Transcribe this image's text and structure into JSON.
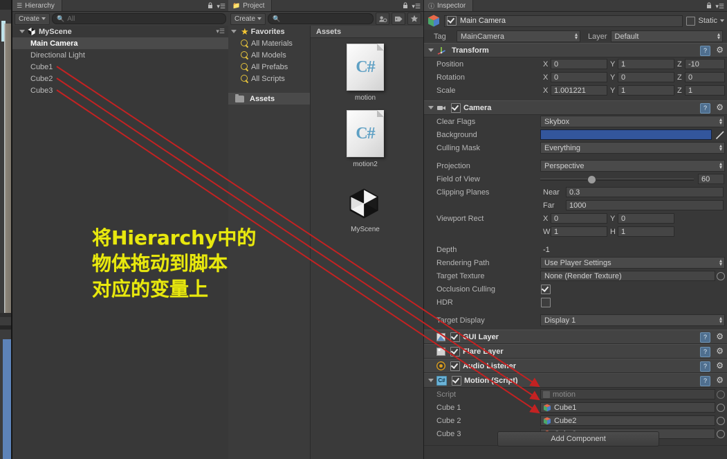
{
  "hierarchy": {
    "tab_label": "Hierarchy",
    "tab_icon": "hierarchy-icon",
    "create_label": "Create",
    "search_placeholder": "All",
    "scene_name": "MyScene",
    "items": [
      {
        "label": "Main Camera",
        "selected": true
      },
      {
        "label": "Directional Light",
        "selected": false
      },
      {
        "label": "Cube1",
        "selected": false
      },
      {
        "label": "Cube2",
        "selected": false
      },
      {
        "label": "Cube3",
        "selected": false
      }
    ]
  },
  "project": {
    "tab_label": "Project",
    "create_label": "Create",
    "search_placeholder": "",
    "toolbar_icons": [
      "filter-by-type-icon",
      "filter-by-label-icon",
      "favorite-star-icon"
    ],
    "favorites_label": "Favorites",
    "favorites": [
      {
        "label": "All Materials"
      },
      {
        "label": "All Models"
      },
      {
        "label": "All Prefabs"
      },
      {
        "label": "All Scripts"
      }
    ],
    "assets_tree_label": "Assets",
    "assets_header": "Assets",
    "assets": [
      {
        "name": "motion",
        "type": "csharp-script"
      },
      {
        "name": "motion2",
        "type": "csharp-script"
      },
      {
        "name": "MyScene",
        "type": "unity-scene"
      }
    ]
  },
  "inspector": {
    "tab_label": "Inspector",
    "object_name": "Main Camera",
    "object_enabled": true,
    "static_label": "Static",
    "static_checked": false,
    "tag_label": "Tag",
    "tag_value": "MainCamera",
    "layer_label": "Layer",
    "layer_value": "Default",
    "transform": {
      "title": "Transform",
      "rows": [
        {
          "label": "Position",
          "x": "0",
          "y": "1",
          "z": "-10"
        },
        {
          "label": "Rotation",
          "x": "0",
          "y": "0",
          "z": "0"
        },
        {
          "label": "Scale",
          "x": "1.001221",
          "y": "1",
          "z": "1"
        }
      ]
    },
    "camera": {
      "title": "Camera",
      "enabled": true,
      "clear_flags_label": "Clear Flags",
      "clear_flags_value": "Skybox",
      "background_label": "Background",
      "background_color": "#33569c",
      "culling_mask_label": "Culling Mask",
      "culling_mask_value": "Everything",
      "projection_label": "Projection",
      "projection_value": "Perspective",
      "fov_label": "Field of View",
      "fov_value": "60",
      "clipping_label": "Clipping Planes",
      "near_label": "Near",
      "near_value": "0.3",
      "far_label": "Far",
      "far_value": "1000",
      "viewport_label": "Viewport Rect",
      "viewport_x": "0",
      "viewport_y": "0",
      "viewport_w": "1",
      "viewport_h": "1",
      "depth_label": "Depth",
      "depth_value": "-1",
      "rendering_path_label": "Rendering Path",
      "rendering_path_value": "Use Player Settings",
      "target_texture_label": "Target Texture",
      "target_texture_value": "None (Render Texture)",
      "occlusion_label": "Occlusion Culling",
      "occlusion_checked": true,
      "hdr_label": "HDR",
      "hdr_checked": false,
      "target_display_label": "Target Display",
      "target_display_value": "Display 1"
    },
    "components": [
      {
        "title": "GUI Layer",
        "enabled": true,
        "icon": "gui-layer-icon"
      },
      {
        "title": "Flare Layer",
        "enabled": true,
        "icon": "flare-layer-icon"
      },
      {
        "title": "Audio Listener",
        "enabled": true,
        "icon": "audio-listener-icon"
      }
    ],
    "script_component": {
      "title": "Motion (Script)",
      "enabled": true,
      "script_label": "Script",
      "script_value": "motion",
      "fields": [
        {
          "label": "Cube 1",
          "value": "Cube1"
        },
        {
          "label": "Cube 2",
          "value": "Cube2"
        },
        {
          "label": "Cube 3",
          "value": "Cube3"
        }
      ]
    },
    "add_component_label": "Add Component"
  },
  "annotation": {
    "line1": "将Hierarchy中的",
    "line2": "物体拖动到脚本",
    "line3": "对应的变量上",
    "color": "#e8e80f",
    "arrow_color": "#c42222"
  }
}
